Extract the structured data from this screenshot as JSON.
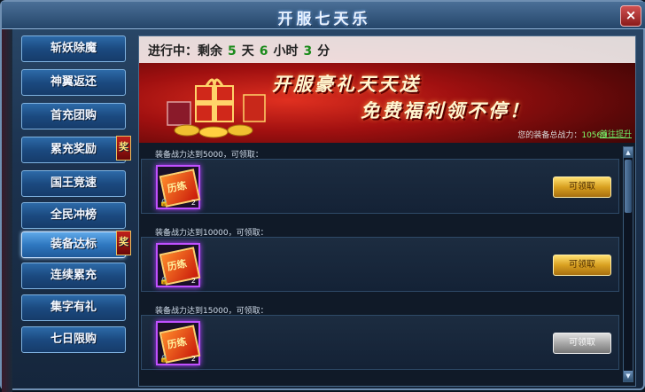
{
  "window": {
    "title": "开服七天乐",
    "close_label": "×"
  },
  "sidebar": {
    "items": [
      {
        "label": "斩妖除魔",
        "badge": ""
      },
      {
        "label": "神翼返还",
        "badge": ""
      },
      {
        "label": "首充团购",
        "badge": ""
      },
      {
        "label": "累充奖励",
        "badge": "奖"
      },
      {
        "label": "国王竞速",
        "badge": ""
      },
      {
        "label": "全民冲榜",
        "badge": ""
      },
      {
        "label": "装备达标",
        "badge": "奖"
      },
      {
        "label": "连续累充",
        "badge": ""
      },
      {
        "label": "集字有礼",
        "badge": ""
      },
      {
        "label": "七日限购",
        "badge": ""
      }
    ],
    "active_index": 6
  },
  "banner": {
    "status_prefix": "进行中：剩余",
    "days": "5",
    "days_unit": "天",
    "hours": "6",
    "hours_unit": "小时",
    "minutes": "3",
    "minutes_unit": "分",
    "slogan_line1": "开服豪礼天天送",
    "slogan_line2": "免费福利领不停！",
    "power_label": "您的装备总战力：",
    "power_value": "10569",
    "upgrade_link": "前往提升"
  },
  "tasks": [
    {
      "label": "装备战力达到5000，可领取：",
      "item_text": "历练",
      "item_count": "2",
      "button": "可领取",
      "claimable": true
    },
    {
      "label": "装备战力达到10000，可领取：",
      "item_text": "历练",
      "item_count": "2",
      "button": "可领取",
      "claimable": true
    },
    {
      "label": "装备战力达到15000，可领取：",
      "item_text": "历练",
      "item_count": "2",
      "button": "可领取",
      "claimable": false
    }
  ],
  "icons": {
    "lock": "lock-icon",
    "scroll_up": "arrow-up-icon",
    "scroll_down": "arrow-down-icon"
  },
  "colors": {
    "accent_gold": "#d8a020",
    "highlight_green": "#7fff6a",
    "item_glow": "#c050ff"
  }
}
